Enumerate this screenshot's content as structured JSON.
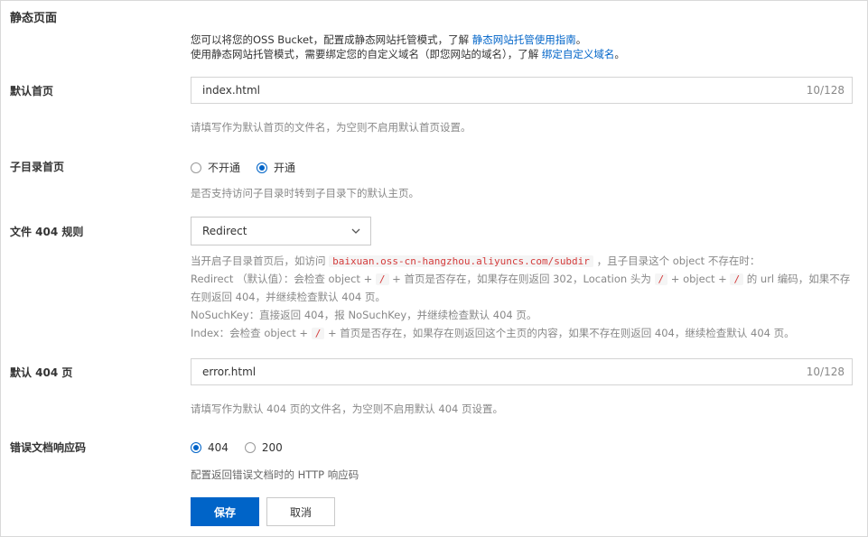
{
  "section_title": "静态页面",
  "intro": {
    "line1_text": "您可以将您的OSS Bucket，配置成静态网站托管模式，了解 ",
    "line1_link": "静态网站托管使用指南",
    "line1_end": "。",
    "line2_text": "使用静态网站托管模式，需要绑定您的自定义域名（即您网站的域名），了解 ",
    "line2_link": "绑定自定义域名",
    "line2_end": "。"
  },
  "default_index": {
    "label": "默认首页",
    "value": "index.html",
    "counter": "10/128",
    "help": "请填写作为默认首页的文件名，为空则不启用默认首页设置。"
  },
  "subdir_index": {
    "label": "子目录首页",
    "options": [
      "不开通",
      "开通"
    ],
    "selected": "开通",
    "help": "是否支持访问子目录时转到子目录下的默认主页。"
  },
  "rule_404": {
    "label": "文件 404 规则",
    "selected": "Redirect",
    "help": {
      "l1a": "当开启子目录首页后，如访问 ",
      "l1_code": "baixuan.oss-cn-hangzhou.aliyuncs.com/subdir",
      "l1b": " ，且子目录这个 object 不存在时：",
      "l2a": "Redirect （默认值）：会检查 object + ",
      "slash": "/",
      "l2b": " + 首页是否存在，如果存在则返回 302，Location 头为 ",
      "l2c": " + object + ",
      "l2d": " 的 url 编码，如果不存",
      "l3": "在则返回 404，并继续检查默认 404 页。",
      "l4": "NoSuchKey：直接返回 404，报 NoSuchKey，并继续检查默认 404 页。",
      "l5a": "Index：会检查 object + ",
      "l5b": " + 首页是否存在，如果存在则返回这个主页的内容，如果不存在则返回 404，继续检查默认 404 页。"
    }
  },
  "default_404": {
    "label": "默认 404 页",
    "value": "error.html",
    "counter": "10/128",
    "help": "请填写作为默认 404 页的文件名，为空则不启用默认 404 页设置。"
  },
  "error_code": {
    "label": "错误文档响应码",
    "options": [
      "404",
      "200"
    ],
    "selected": "404",
    "help": "配置返回错误文档时的 HTTP 响应码"
  },
  "buttons": {
    "save": "保存",
    "cancel": "取消"
  },
  "colors": {
    "accent": "#0064c8",
    "code_red": "#d43c3c",
    "help_gray": "#888888"
  }
}
